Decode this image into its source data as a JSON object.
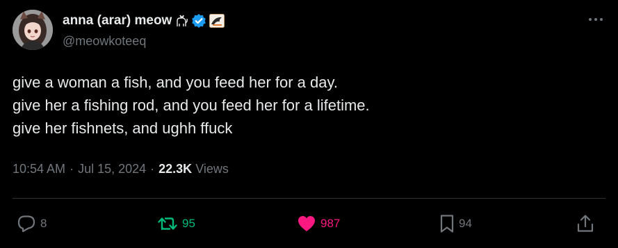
{
  "author": {
    "display_name": "anna (arar) meow",
    "handle": "@meowkoteeq",
    "badge_icons": [
      "cat-emoji-icon",
      "verified-badge-icon",
      "affiliate-badge-icon"
    ]
  },
  "tweet": {
    "lines": [
      "give a woman a fish, and you feed her for a day.",
      "give her a fishing rod, and you feed her for a lifetime.",
      "give her fishnets, and ughh ffuck"
    ],
    "time": "10:54 AM",
    "date": "Jul 15, 2024",
    "separator": "·",
    "views_count": "22.3K",
    "views_label": "Views"
  },
  "actions": {
    "replies": "8",
    "retweets": "95",
    "likes": "987",
    "bookmarks": "94"
  },
  "colors": {
    "background": "#000000",
    "text": "#e7e9ea",
    "muted": "#71767b",
    "verified": "#1d9bf0",
    "retweet": "#00ba7c",
    "like": "#f91880",
    "divider": "#2f3336"
  }
}
